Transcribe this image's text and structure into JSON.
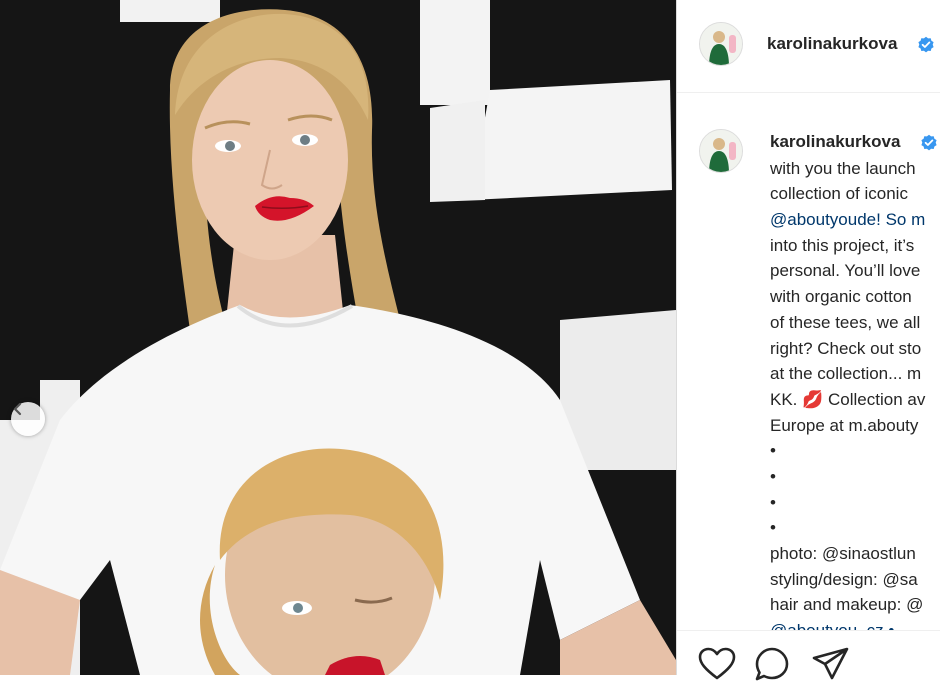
{
  "post": {
    "username": "karolinakurkova",
    "caption_lines": [
      "",
      "with you the launch",
      "collection of iconic",
      "@aboutyoude! So m",
      "into this project, it’s",
      "personal. You’ll love",
      "with organic cotton",
      "of these tees, we all",
      "right? Check out sto",
      "at the collection... m",
      "KK. 💋 Collection av",
      "Europe at m.abouty",
      "•",
      "•",
      "•",
      "•",
      "photo: @sinaostlun",
      "styling/design: @sa",
      "hair and makeup: @",
      "@aboutyou_cz •"
    ]
  },
  "icons": {
    "verified": "verified-badge-icon",
    "prev": "chevron-left-icon",
    "like": "heart-icon",
    "comment": "comment-icon",
    "share": "paper-plane-icon"
  },
  "colors": {
    "text": "#262626",
    "mention": "#00376b",
    "verified": "#3897f0",
    "border": "#efefef"
  }
}
